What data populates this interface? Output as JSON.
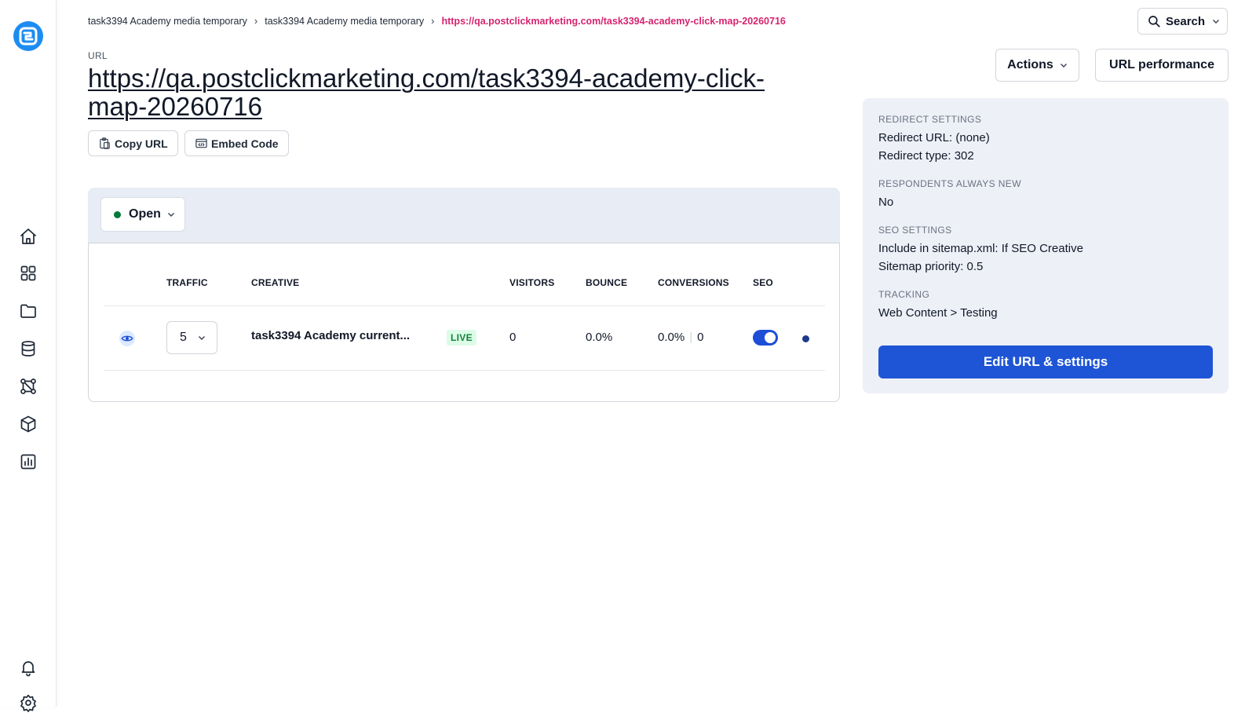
{
  "breadcrumb": {
    "items": [
      "task3394 Academy media temporary",
      "task3394 Academy media temporary"
    ],
    "current": "https://qa.postclickmarketing.com/task3394-academy-click-map-20260716"
  },
  "search": {
    "label": "Search"
  },
  "header": {
    "url_label": "URL",
    "url_title": "https://qa.postclickmarketing.com/task3394-academy-click-map-20260716",
    "copy_url": "Copy URL",
    "embed_code": "Embed Code",
    "actions": "Actions",
    "url_performance": "URL performance"
  },
  "status": {
    "label": "Open",
    "color": "#047a3a"
  },
  "table": {
    "headers": [
      "TRAFFIC",
      "CREATIVE",
      "VISITORS",
      "BOUNCE",
      "CONVERSIONS",
      "SEO"
    ],
    "rows": [
      {
        "traffic": "5",
        "creative": "task3394 Academy current...",
        "badge": "LIVE",
        "visitors": "0",
        "bounce": "0.0%",
        "conversion_rate": "0.0%",
        "conversions": "0",
        "seo_enabled": true
      }
    ]
  },
  "settings": {
    "redirect_title": "REDIRECT SETTINGS",
    "redirect_url": "Redirect URL: (none)",
    "redirect_type": "Redirect type: 302",
    "respondents_title": "RESPONDENTS ALWAYS NEW",
    "respondents_value": "No",
    "seo_title": "SEO SETTINGS",
    "seo_sitemap": "Include in sitemap.xml: If SEO Creative",
    "seo_priority": "Sitemap priority: 0.5",
    "tracking_title": "TRACKING",
    "tracking_value": "Web Content > Testing",
    "edit_button": "Edit URL & settings"
  },
  "sidebar": {
    "icons": [
      "home-icon",
      "grid-icon",
      "folder-icon",
      "database-icon",
      "workflow-icon",
      "cube-icon",
      "chart-icon",
      "bell-icon",
      "settings-icon"
    ]
  },
  "colors": {
    "accent": "#1e55d6",
    "breadcrumb_current": "#d6246f",
    "live_badge": "#15803d"
  }
}
